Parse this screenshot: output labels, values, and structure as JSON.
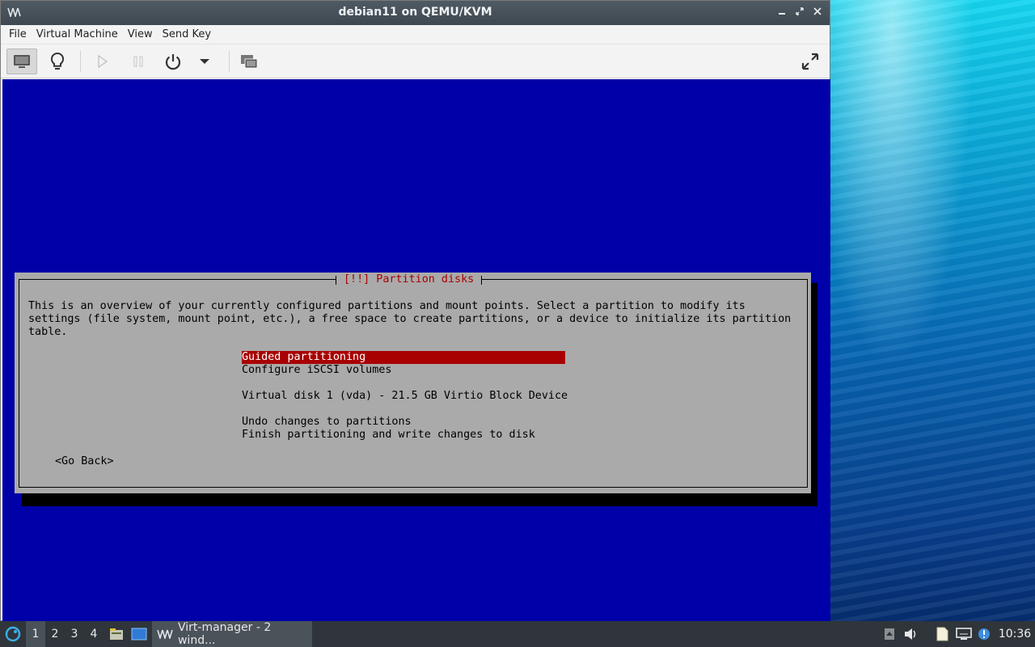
{
  "window": {
    "title": "debian11 on QEMU/KVM",
    "controls": [
      "minimize",
      "restore",
      "close"
    ]
  },
  "menubar": {
    "items": [
      "File",
      "Virtual Machine",
      "View",
      "Send Key"
    ]
  },
  "toolbar": {
    "buttons": [
      {
        "icon": "monitor-icon",
        "state": "active"
      },
      {
        "icon": "lightbulb-icon"
      },
      {
        "icon": "play-icon",
        "state": "disabled"
      },
      {
        "icon": "pause-icon",
        "state": "disabled"
      },
      {
        "icon": "power-icon"
      },
      {
        "icon": "chevron-down-icon"
      },
      {
        "icon": "snapshots-icon"
      },
      {
        "icon": "fullscreen-icon"
      }
    ]
  },
  "installer": {
    "dialog_title": "[!!] Partition disks",
    "description_lines": [
      "This is an overview of your currently configured partitions and mount points. Select a partition to modify its",
      "settings (file system, mount point, etc.), a free space to create partitions, or a device to initialize its partition",
      "table."
    ],
    "options": [
      {
        "label": "Guided partitioning",
        "selected": true
      },
      {
        "label": "Configure iSCSI volumes",
        "selected": false
      },
      {
        "label": "Virtual disk 1 (vda) - 21.5 GB Virtio Block Device",
        "selected": false
      },
      {
        "label": "Undo changes to partitions",
        "selected": false
      },
      {
        "label": "Finish partitioning and write changes to disk",
        "selected": false
      }
    ],
    "go_back": "<Go Back>"
  },
  "taskbar": {
    "workspaces": [
      "1",
      "2",
      "3",
      "4"
    ],
    "active_workspace": "1",
    "task_label": "Virt-manager - 2 wind...",
    "clock": "10:36"
  },
  "colors": {
    "console_bg": "#0000a8",
    "dialog_bg": "#aaaaaa",
    "selection": "#a80000",
    "taskbar": "#2f353b"
  }
}
